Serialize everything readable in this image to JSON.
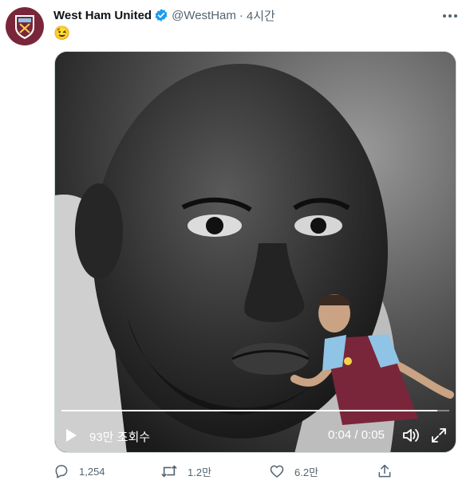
{
  "account": {
    "display_name": "West Ham United",
    "handle": "@WestHam",
    "separator": "·",
    "time_ago": "4시간",
    "verified": true,
    "brand_color": "#7a263a"
  },
  "tweet": {
    "text": "😉"
  },
  "video": {
    "views": "93만 조회수",
    "current_time": "0:04",
    "time_divider": "/",
    "duration": "0:05",
    "progress": 0.97,
    "play_icon": "play-icon",
    "volume_icon": "volume-icon",
    "fullscreen_icon": "fullscreen-icon"
  },
  "actions": {
    "replies": "1,254",
    "retweets": "1.2만",
    "likes": "6.2만",
    "reply_icon": "reply-icon",
    "retweet_icon": "retweet-icon",
    "like_icon": "heart-icon",
    "share_icon": "share-icon"
  },
  "colors": {
    "verified_blue": "#1d9bf0",
    "text_secondary": "#536471",
    "kit_claret": "#7a263a",
    "kit_blue": "#8fc4e6"
  }
}
